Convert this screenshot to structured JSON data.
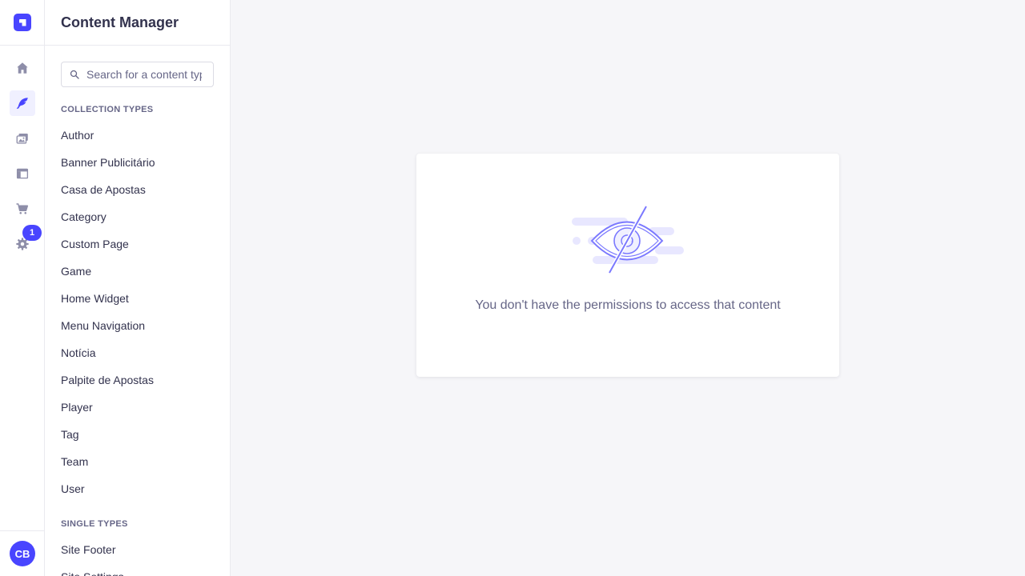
{
  "app": {
    "logo_icon": "strapi-logo-icon",
    "accent": "#4945ff"
  },
  "rail": {
    "items": [
      {
        "name": "home",
        "icon": "home-icon",
        "active": false
      },
      {
        "name": "content-manager",
        "icon": "feather-icon",
        "active": true
      },
      {
        "name": "media-library",
        "icon": "images-icon",
        "active": false
      },
      {
        "name": "content-type-builder",
        "icon": "layout-icon",
        "active": false
      },
      {
        "name": "marketplace",
        "icon": "cart-icon",
        "active": false
      },
      {
        "name": "settings",
        "icon": "gear-icon",
        "active": false
      }
    ],
    "settings_badge": "1",
    "avatar_initials": "CB"
  },
  "sidenav": {
    "title": "Content Manager",
    "search_placeholder": "Search for a content type",
    "collection_label": "COLLECTION TYPES",
    "collection_types": [
      "Author",
      "Banner Publicitário",
      "Casa de Apostas",
      "Category",
      "Custom Page",
      "Game",
      "Home Widget",
      "Menu Navigation",
      "Notícia",
      "Palpite de Apostas",
      "Player",
      "Tag",
      "Team",
      "User"
    ],
    "single_label": "SINGLE TYPES",
    "single_types": [
      "Site Footer",
      "Site Settings"
    ]
  },
  "main": {
    "illustration_icon": "eye-slash-icon",
    "message": "You don't have the permissions to access that content"
  }
}
